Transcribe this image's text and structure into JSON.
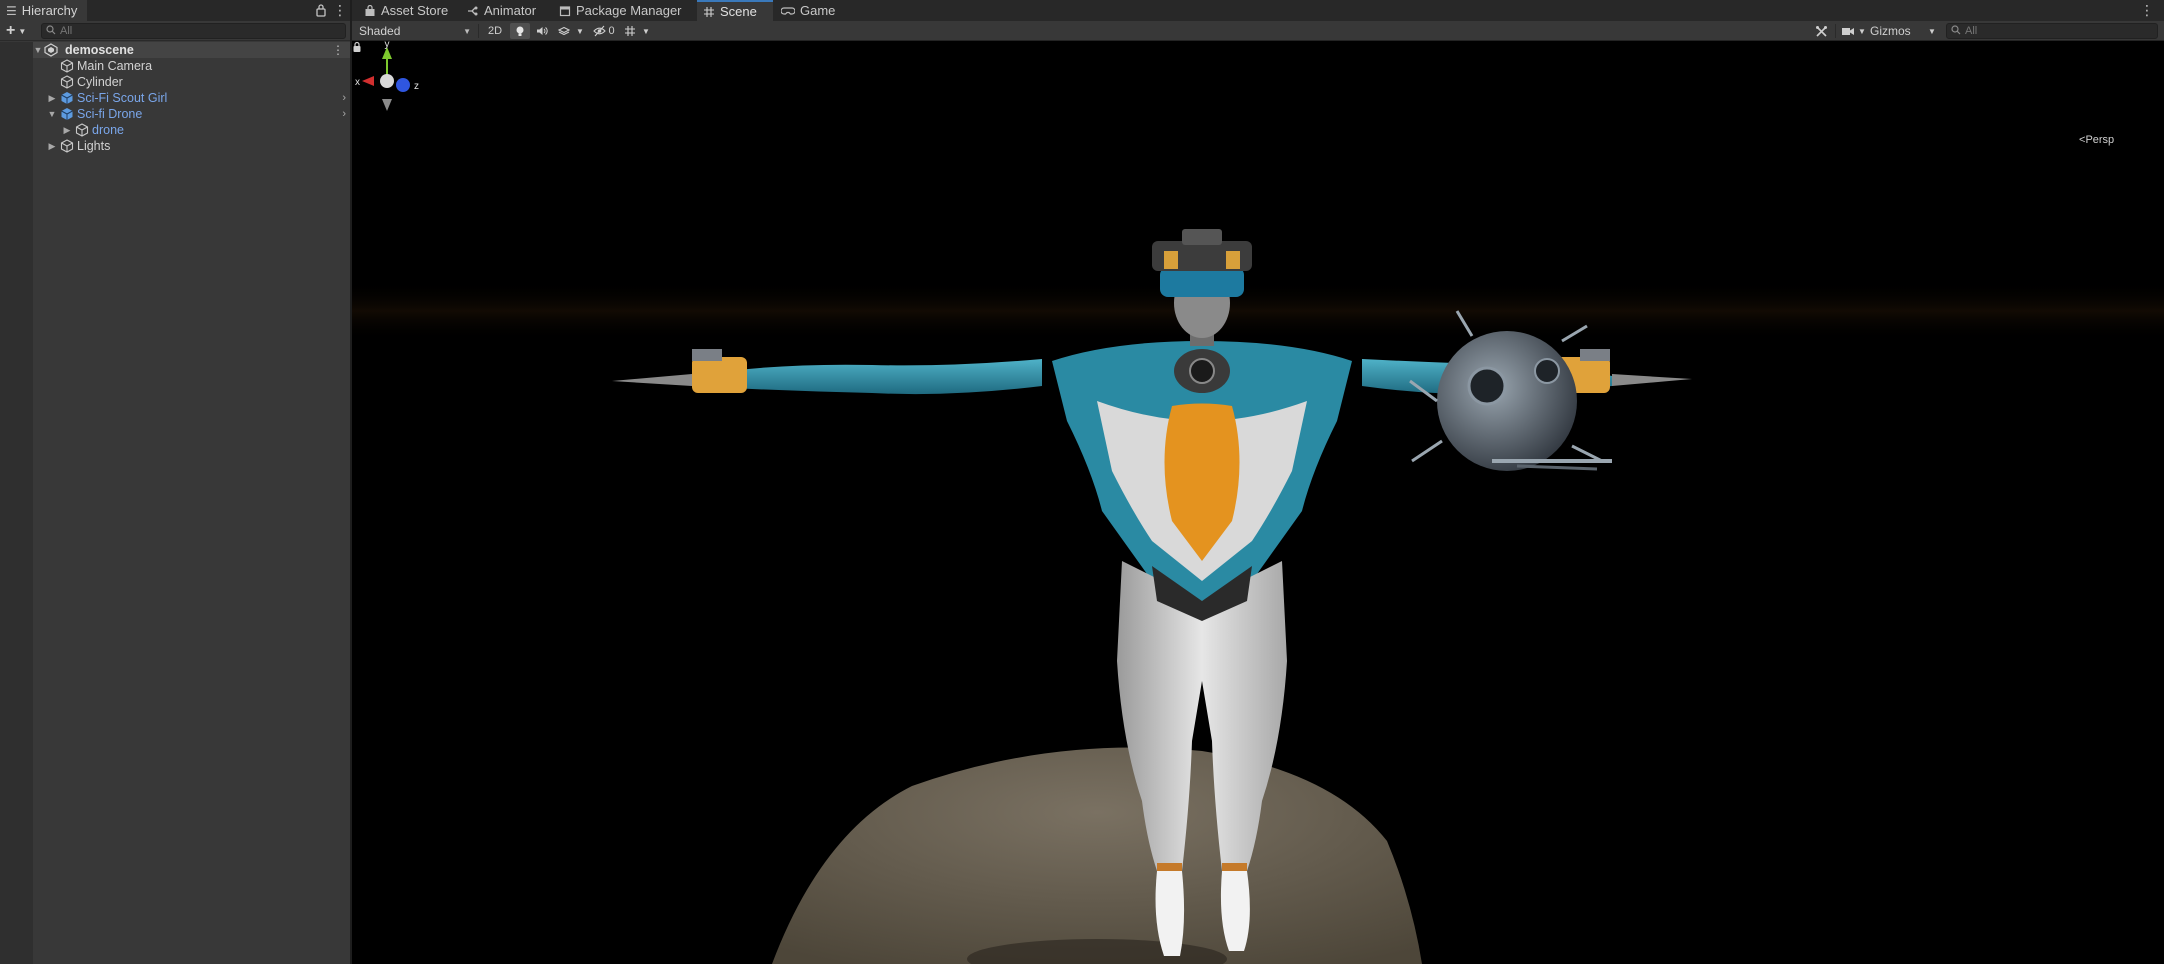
{
  "hierarchy": {
    "tab_label": "Hierarchy",
    "search_placeholder": "All",
    "scene_name": "demoscene",
    "items": [
      {
        "label": "Main Camera",
        "kind": "gameobject"
      },
      {
        "label": "Cylinder",
        "kind": "gameobject"
      },
      {
        "label": "Sci-Fi Scout Girl",
        "kind": "prefab"
      },
      {
        "label": "Sci-fi Drone",
        "kind": "prefab"
      },
      {
        "label": "drone",
        "kind": "prefab"
      },
      {
        "label": "Lights",
        "kind": "gameobject"
      }
    ]
  },
  "tabs": [
    {
      "label": "Asset Store",
      "icon": "shopping-bag-icon"
    },
    {
      "label": "Animator",
      "icon": "animator-icon"
    },
    {
      "label": "Package Manager",
      "icon": "package-icon"
    },
    {
      "label": "Scene",
      "icon": "grid-icon",
      "active": true
    },
    {
      "label": "Game",
      "icon": "gamepad-icon"
    }
  ],
  "scene_toolbar": {
    "draw_mode": "Shaded",
    "mode_2d": "2D",
    "hidden_count": "0",
    "gizmos_label": "Gizmos",
    "search_placeholder": "All"
  },
  "viewport": {
    "projection_label": "Persp",
    "axis_labels": {
      "x": "x",
      "y": "y",
      "z": "z"
    }
  },
  "colors": {
    "accent": "#3a79bb",
    "prefab_text": "#7aa6ea",
    "axis_x": "#d22f2f",
    "axis_y": "#7ec92e",
    "axis_z": "#2f56e0"
  }
}
